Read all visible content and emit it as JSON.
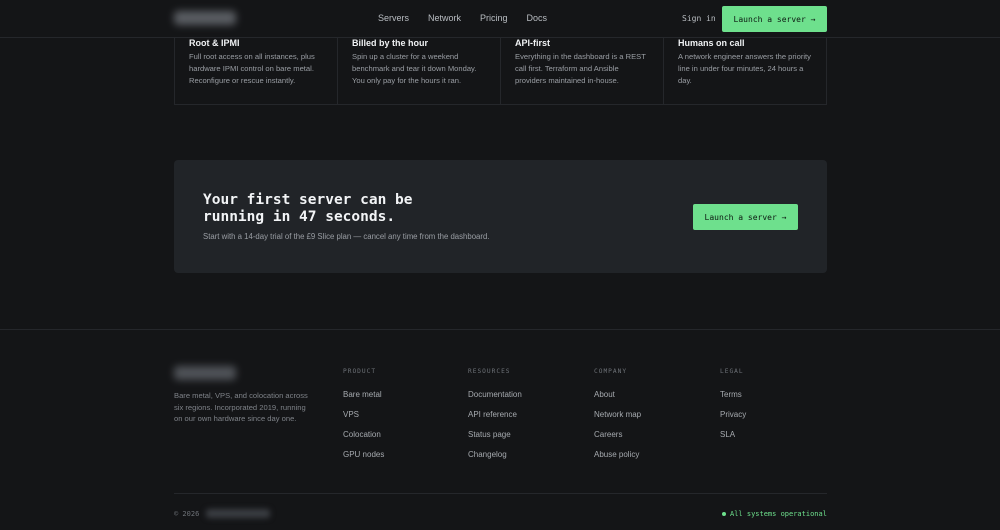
{
  "header": {
    "nav": [
      "Servers",
      "Network",
      "Pricing",
      "Docs"
    ],
    "signin": "Sign in",
    "cta_label": "Launch a server →"
  },
  "features": [
    {
      "title": "Root & IPMI",
      "desc": "Full root access on all instances, plus hardware IPMI control on bare metal. Reconfigure or rescue instantly."
    },
    {
      "title": "Billed by the hour",
      "desc": "Spin up a cluster for a weekend benchmark and tear it down Monday. You only pay for the hours it ran."
    },
    {
      "title": "API-first",
      "desc": "Everything in the dashboard is a REST call first. Terraform and Ansible providers maintained in-house."
    },
    {
      "title": "Humans on call",
      "desc": "A network engineer answers the priority line in under four minutes, 24 hours a day."
    }
  ],
  "cta": {
    "heading_line1": "Your first server can be",
    "heading_line2": "running in 47 seconds.",
    "subtext": "Start with a 14-day trial of the £9 Slice plan — cancel any time from the dashboard.",
    "button": "Launch a server →"
  },
  "footer": {
    "description": "Bare metal, VPS, and colocation across six regions. Incorporated 2019, running on our own hardware since day one.",
    "columns": [
      {
        "heading": "PRODUCT",
        "links": [
          "Bare metal",
          "VPS",
          "Colocation",
          "GPU nodes"
        ]
      },
      {
        "heading": "RESOURCES",
        "links": [
          "Documentation",
          "API reference",
          "Status page",
          "Changelog"
        ]
      },
      {
        "heading": "COMPANY",
        "links": [
          "About",
          "Network map",
          "Careers",
          "Abuse policy"
        ]
      },
      {
        "heading": "LEGAL",
        "links": [
          "Terms",
          "Privacy",
          "SLA"
        ]
      }
    ],
    "copyright": "© 2026",
    "status": "All systems operational"
  },
  "colors": {
    "accent": "#6ee08d",
    "background": "#141517",
    "card": "#212428"
  }
}
